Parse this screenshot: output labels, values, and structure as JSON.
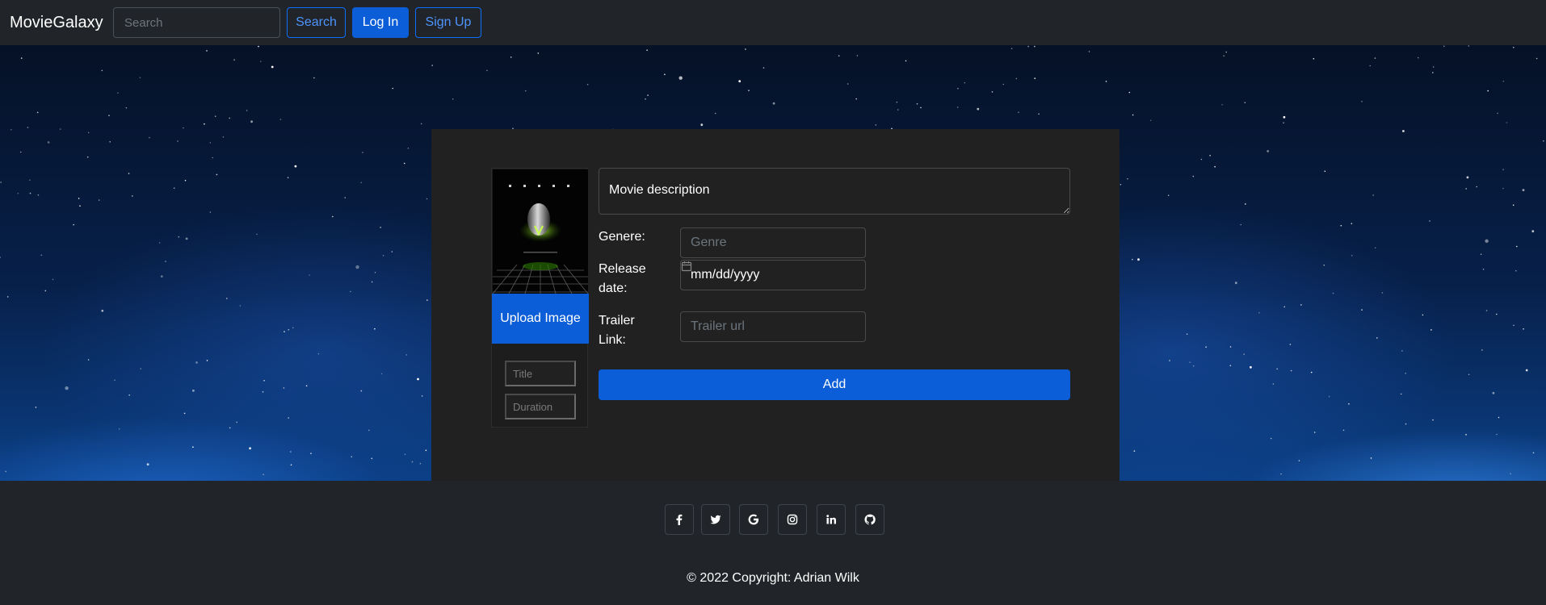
{
  "navbar": {
    "brand": "MovieGalaxy",
    "search_placeholder": "Search",
    "search_button": "Search",
    "login_button": "Log In",
    "signup_button": "Sign Up"
  },
  "form": {
    "poster_image": "alien-movie-poster",
    "upload_button": "Upload Image",
    "title_placeholder": "Title",
    "duration_placeholder": "Duration",
    "description_placeholder": "Movie description",
    "genre_label": "Genere:",
    "genre_placeholder": "Genre",
    "release_label": "Release date:",
    "release_value": "mm/dd/yyyy",
    "trailer_label": "Trailer Link:",
    "trailer_placeholder": "Trailer url",
    "add_button": "Add"
  },
  "footer": {
    "social_icons": [
      "facebook-icon",
      "twitter-icon",
      "google-icon",
      "instagram-icon",
      "linkedin-icon",
      "github-icon"
    ],
    "copyright": "© 2022 Copyright: Adrian Wilk"
  },
  "colors": {
    "primary": "#0b5ed7",
    "navbar_bg": "#212529",
    "card_bg": "#212121"
  }
}
